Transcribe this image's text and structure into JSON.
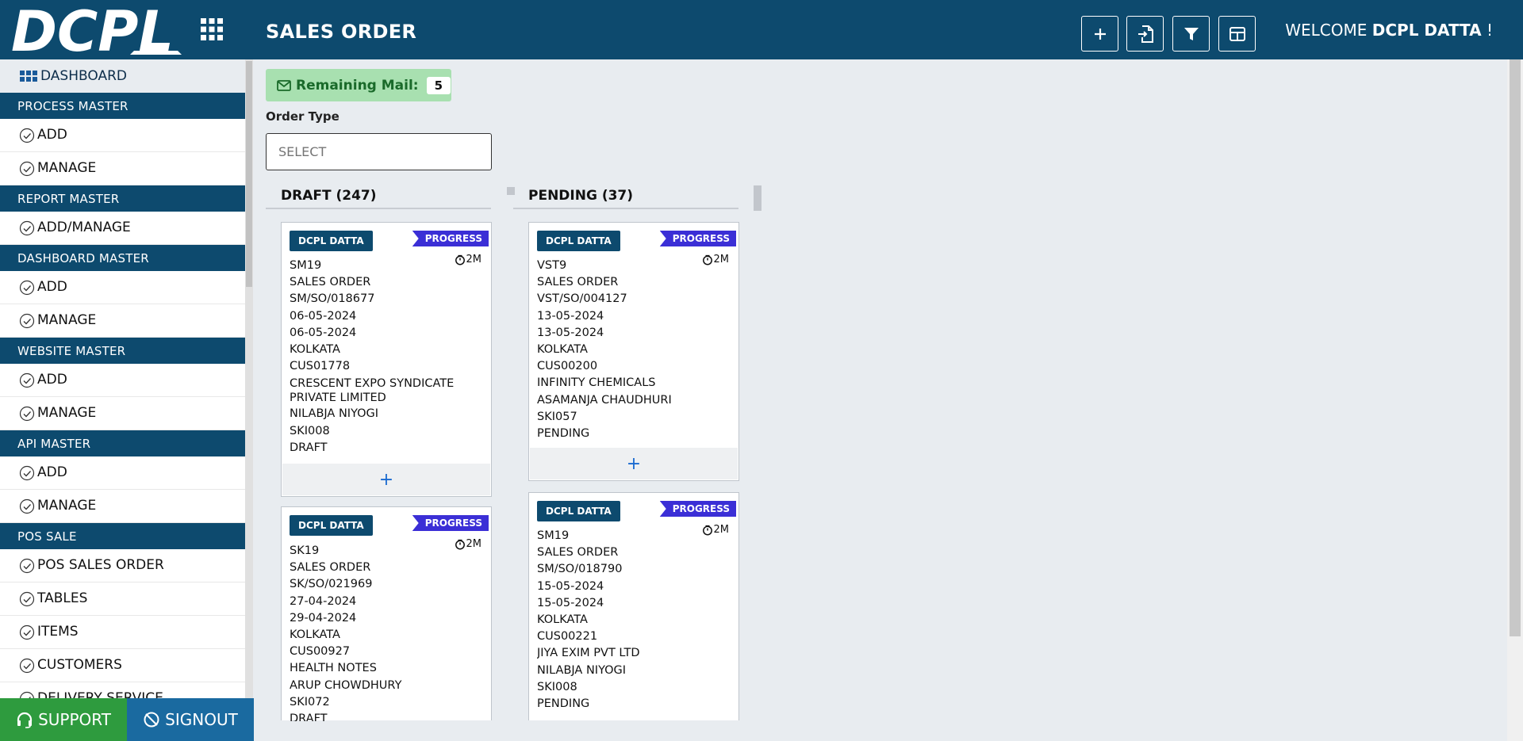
{
  "header": {
    "logo_text": "DCPL",
    "title": "SALES ORDER",
    "welcome_prefix": "WELCOME",
    "welcome_user": "DCPL DATTA",
    "welcome_suffix": "!",
    "buttons": [
      "plus-icon",
      "file-import-icon",
      "filter-icon",
      "table-icon"
    ]
  },
  "sidebar": {
    "dashboard_label": "DASHBOARD",
    "sections": [
      {
        "title": "PROCESS MASTER",
        "items": [
          "ADD",
          "MANAGE"
        ]
      },
      {
        "title": "REPORT MASTER",
        "items": [
          "ADD/MANAGE"
        ]
      },
      {
        "title": "DASHBOARD MASTER",
        "items": [
          "ADD",
          "MANAGE"
        ]
      },
      {
        "title": "WEBSITE MASTER",
        "items": [
          "ADD",
          "MANAGE"
        ]
      },
      {
        "title": "API MASTER",
        "items": [
          "ADD",
          "MANAGE"
        ]
      },
      {
        "title": "POS SALE",
        "items": [
          "POS SALES ORDER",
          "TABLES",
          "ITEMS",
          "CUSTOMERS",
          "DELIVERY SERVICE PROVIDERS"
        ]
      }
    ],
    "support_label": "SUPPORT",
    "signout_label": "SIGNOUT"
  },
  "main": {
    "mail_label": "Remaining Mail:",
    "mail_count": "5",
    "order_type_label": "Order Type",
    "order_type_placeholder": "SELECT",
    "columns": [
      {
        "title": "DRAFT (247)",
        "cards": [
          {
            "assignee": "DCPL DATTA",
            "status": "PROGRESS",
            "age": "2M",
            "lines": [
              "SM19",
              "SALES ORDER",
              "SM/SO/018677",
              "06-05-2024",
              "06-05-2024",
              "KOLKATA",
              "CUS01778",
              "CRESCENT EXPO SYNDICATE PRIVATE LIMITED",
              "NILABJA NIYOGI",
              "SKI008",
              "DRAFT"
            ]
          },
          {
            "assignee": "DCPL DATTA",
            "status": "PROGRESS",
            "age": "2M",
            "lines": [
              "SK19",
              "SALES ORDER",
              "SK/SO/021969",
              "27-04-2024",
              "29-04-2024",
              "KOLKATA",
              "CUS00927",
              "HEALTH NOTES",
              "ARUP CHOWDHURY",
              "SKI072",
              "DRAFT"
            ]
          }
        ]
      },
      {
        "title": "PENDING (37)",
        "cards": [
          {
            "assignee": "DCPL DATTA",
            "status": "PROGRESS",
            "age": "2M",
            "lines": [
              "VST9",
              "SALES ORDER",
              "VST/SO/004127",
              "13-05-2024",
              "13-05-2024",
              "KOLKATA",
              "CUS00200",
              "INFINITY CHEMICALS",
              "ASAMANJA CHAUDHURI",
              "SKI057",
              "PENDING"
            ]
          },
          {
            "assignee": "DCPL DATTA",
            "status": "PROGRESS",
            "age": "2M",
            "lines": [
              "SM19",
              "SALES ORDER",
              "SM/SO/018790",
              "15-05-2024",
              "15-05-2024",
              "KOLKATA",
              "CUS00221",
              "JIYA EXIM PVT LTD",
              "NILABJA NIYOGI",
              "SKI008",
              "PENDING"
            ]
          }
        ]
      }
    ],
    "add_symbol": "+"
  }
}
